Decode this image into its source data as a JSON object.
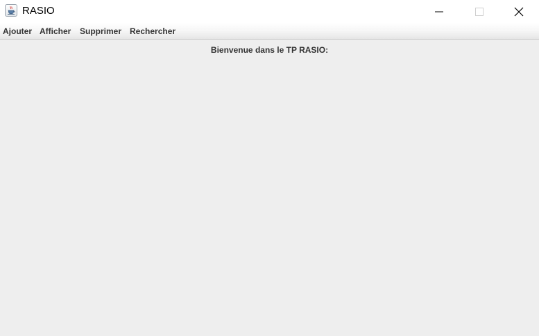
{
  "window": {
    "title": "RASIO",
    "icon": "java-cup-icon",
    "controls": [
      "minimize-icon",
      "maximize-icon",
      "close-icon"
    ]
  },
  "menubar": {
    "items": [
      {
        "label": "Ajouter"
      },
      {
        "label": "Afficher"
      },
      {
        "label": "Supprimer"
      },
      {
        "label": "Rechercher"
      }
    ]
  },
  "content": {
    "welcome_text": "Bienvenue dans le TP RASIO:"
  },
  "colors": {
    "titlebar_bg": "#ffffff",
    "content_bg": "#eeeeee",
    "menu_text": "#333333"
  }
}
